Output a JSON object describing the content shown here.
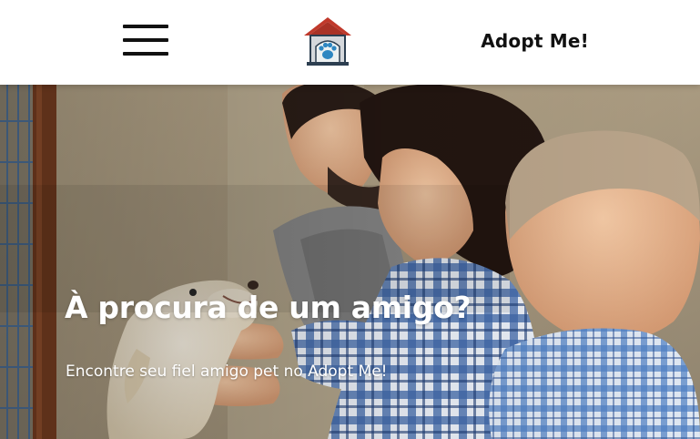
{
  "header": {
    "menu_icon": "hamburger-menu-icon",
    "logo_icon": "house-paw-icon",
    "brand": "Adopt Me!"
  },
  "hero": {
    "title": "À procura de um amigo?",
    "subtitle": "Encontre seu fiel amigo pet no Adopt Me!"
  },
  "colors": {
    "header_bg": "#ffffff",
    "logo_roof": "#c0392b",
    "logo_paw": "#2e86c1",
    "hero_text": "#ffffff"
  }
}
